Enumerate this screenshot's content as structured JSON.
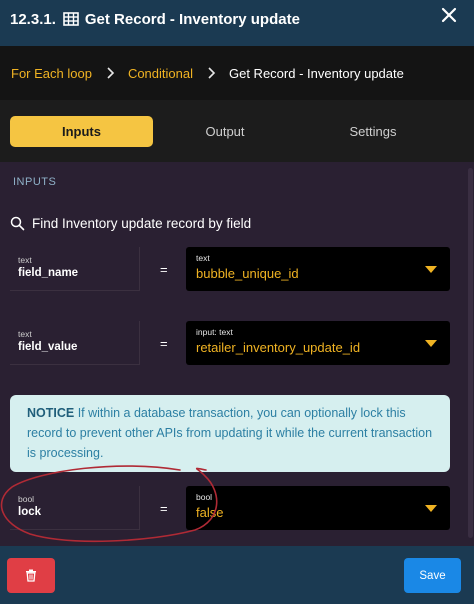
{
  "header": {
    "step": "12.3.1.",
    "title": "Get Record - Inventory update",
    "grid_icon": "grid-icon",
    "close_icon": "close-icon"
  },
  "breadcrumb": {
    "items": [
      "For Each loop",
      "Conditional",
      "Get Record - Inventory update"
    ]
  },
  "tabs": {
    "items": [
      {
        "label": "Inputs",
        "active": true
      },
      {
        "label": "Output",
        "active": false
      },
      {
        "label": "Settings",
        "active": false
      }
    ]
  },
  "inputs": {
    "section_label": "INPUTS",
    "find_text": "Find Inventory update record by field",
    "fields": [
      {
        "type": "text",
        "name": "field_name",
        "operator": "=",
        "value_type": "text",
        "value": "bubble_unique_id"
      },
      {
        "type": "text",
        "name": "field_value",
        "operator": "=",
        "value_type": "input: text",
        "value": "retailer_inventory_update_id"
      },
      {
        "type": "bool",
        "name": "lock",
        "operator": "=",
        "value_type": "bool",
        "value": "false"
      }
    ]
  },
  "notice": {
    "label": "NOTICE",
    "text": " If within a database transaction, you can optionally lock this record to prevent other APIs from updating it while the current transaction is processing."
  },
  "footer": {
    "save_label": "Save",
    "delete_icon": "trash-icon"
  },
  "colors": {
    "header_bg": "#1b3a52",
    "accent": "#f5c542",
    "link": "#f0b323",
    "notice_bg": "#d6efef",
    "delete": "#e03e45",
    "save": "#1a88e6",
    "annotation": "#b02a35"
  }
}
